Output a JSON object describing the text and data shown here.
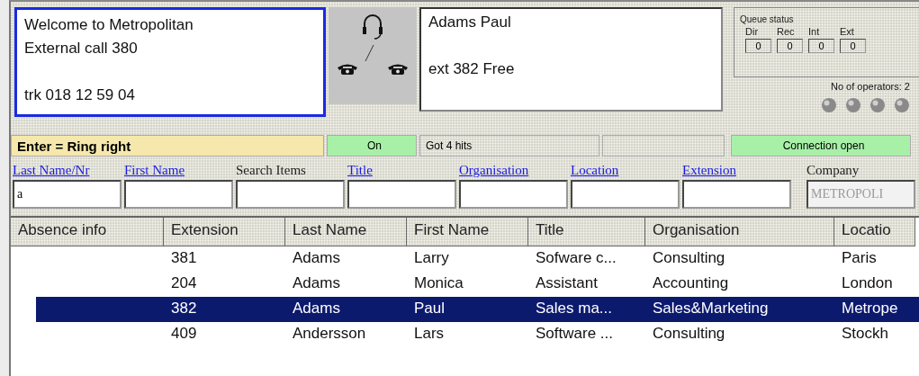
{
  "caller_box": {
    "lines": [
      "Welcome to Metropolitan",
      "External call 380"
    ],
    "trunk": "trk 018 12 59 04",
    "focused": true
  },
  "person_box": {
    "name": "Adams Paul",
    "status": "ext 382 Free"
  },
  "queue_status": {
    "title": "Queue status",
    "counters": [
      {
        "label": "Dir",
        "value": "0"
      },
      {
        "label": "Rec",
        "value": "0"
      },
      {
        "label": "Int",
        "value": "0"
      },
      {
        "label": "Ext",
        "value": "0"
      }
    ],
    "operators": "No of operators: 2"
  },
  "status_bar": [
    {
      "text": "Enter = Ring right",
      "kind": "hint"
    },
    {
      "text": "On",
      "kind": "ok"
    },
    {
      "text": "Got 4 hits",
      "kind": "plain"
    },
    {
      "kind": "plain"
    },
    {
      "text": "Connection open",
      "kind": "ok"
    }
  ],
  "search": [
    {
      "label": "Last Name/Nr",
      "kind": "link",
      "value": "a"
    },
    {
      "label": "First Name",
      "kind": "link"
    },
    {
      "label": "Search Items",
      "kind": "plain"
    },
    {
      "label": "Title",
      "kind": "link"
    },
    {
      "label": "Organisation",
      "kind": "link"
    },
    {
      "label": "Location",
      "kind": "link"
    },
    {
      "label": "Extension",
      "kind": "link"
    },
    {
      "label": "Company",
      "kind": "plain",
      "value": "METROPOLI",
      "disabled": true
    }
  ],
  "table": {
    "columns": [
      "Absence info",
      "Extension",
      "Last Name",
      "First Name",
      "Title",
      "Organisation",
      "Locatio"
    ],
    "rows": [
      {
        "cells": [
          "",
          "381",
          "Adams",
          "Larry",
          "Sofware c...",
          "Consulting",
          "Paris"
        ],
        "selected": false
      },
      {
        "cells": [
          "",
          "204",
          "Adams",
          "Monica",
          "Assistant",
          "Accounting",
          "London"
        ],
        "selected": false
      },
      {
        "cells": [
          "",
          "382",
          "Adams",
          "Paul",
          "Sales ma...",
          "Sales&Marketing",
          "Metrope"
        ],
        "selected": true
      },
      {
        "cells": [
          "",
          "409",
          "Andersson",
          "Lars",
          "Software ...",
          "Consulting",
          "Stockh"
        ],
        "selected": false
      }
    ]
  }
}
